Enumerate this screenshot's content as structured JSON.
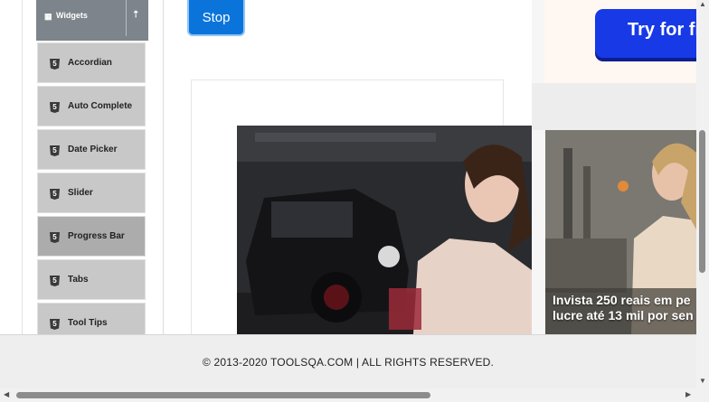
{
  "sidebar": {
    "group_label": "Widgets",
    "group_icon": "grid-icon",
    "toggle_icon": "upload-icon",
    "items": [
      {
        "label": "Accordian"
      },
      {
        "label": "Auto Complete"
      },
      {
        "label": "Date Picker"
      },
      {
        "label": "Slider"
      },
      {
        "label": "Progress Bar",
        "active": true
      },
      {
        "label": "Tabs"
      },
      {
        "label": "Tool Tips"
      }
    ]
  },
  "main": {
    "stop_button_label": "Stop"
  },
  "ads": {
    "try_button_label": "Try for fr",
    "caption_line1": "Invista 250 reais em pe",
    "caption_line2": "lucre até 13 mil por sen"
  },
  "footer": {
    "text": "© 2013-2020 TOOLSQA.COM | ALL RIGHTS RESERVED."
  },
  "colors": {
    "accent": "#0a74da",
    "sidebar_header": "#7d848b",
    "menu_item": "#c8c8c8",
    "menu_item_active": "#acacac",
    "ad_button": "#1739e6"
  }
}
